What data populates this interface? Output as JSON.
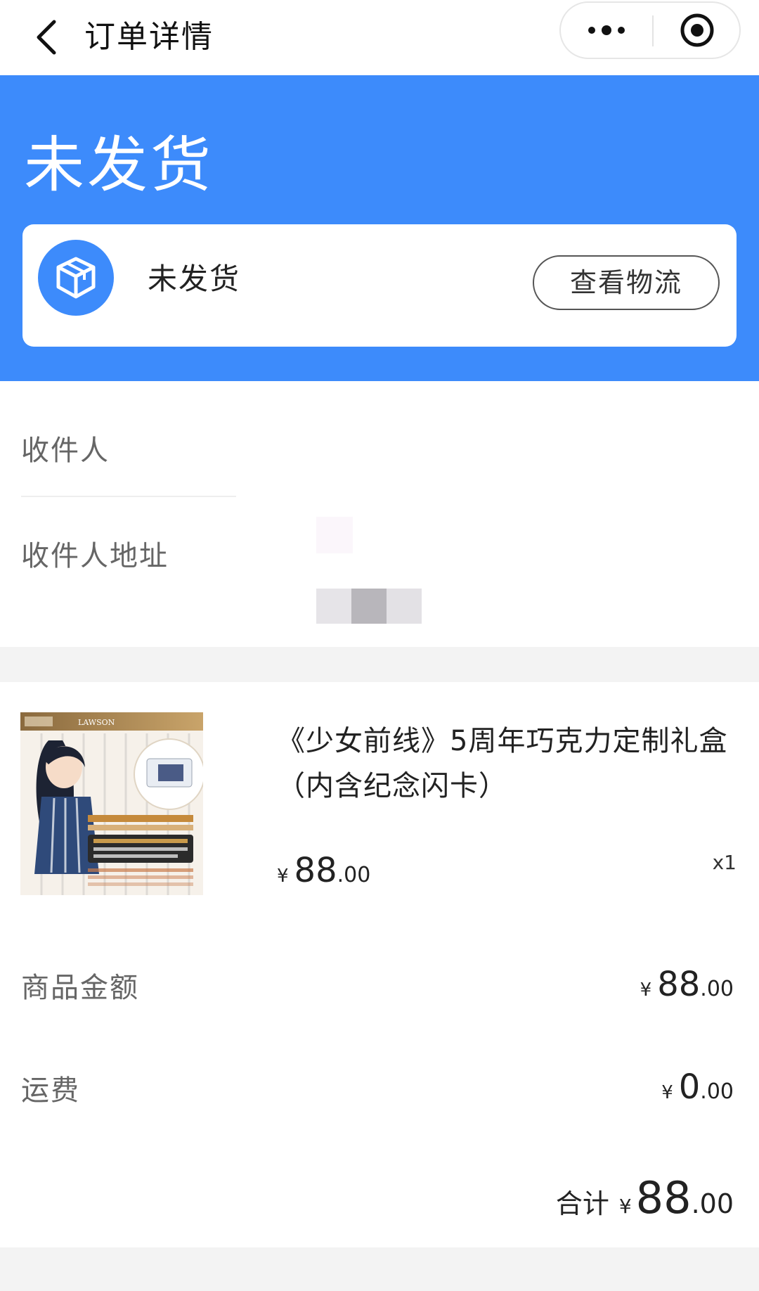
{
  "nav": {
    "back_icon": "chevron-left-icon",
    "title": "订单详情",
    "more_icon": "more-dots-icon",
    "close_icon": "target-close-icon"
  },
  "hero": {
    "status_title": "未发货",
    "background_color": "#3d8bfb"
  },
  "status_card": {
    "icon": "package-box-icon",
    "status_text": "未发货",
    "logistics_button": "查看物流"
  },
  "receiver": {
    "name_label": "收件人",
    "address_label": "收件人地址"
  },
  "product": {
    "image_brand": "LAWSON",
    "title": "《少女前线》5周年巧克力定制礼盒（内含纪念闪卡）",
    "currency": "¥",
    "price_int": "88",
    "price_dec": ".00",
    "quantity": "x1"
  },
  "summary": {
    "goods_label": "商品金额",
    "goods_currency": "¥",
    "goods_int": "88",
    "goods_dec": ".00",
    "shipping_label": "运费",
    "shipping_currency": "¥",
    "shipping_int": "0",
    "shipping_dec": ".00",
    "total_label": "合计",
    "total_currency": "¥",
    "total_int": "88",
    "total_dec": ".00"
  }
}
